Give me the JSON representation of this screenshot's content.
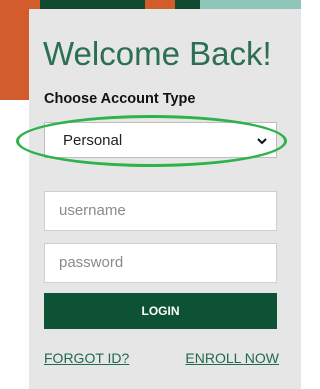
{
  "colors": {
    "brand_green": "#0e5235",
    "title_green": "#2c6f52",
    "accent_orange": "#d25c2c",
    "highlight_green": "#2db34a",
    "panel_bg": "#e6e6e6"
  },
  "login_panel": {
    "title": "Welcome Back!",
    "account_type_label": "Choose Account Type",
    "account_type_select": {
      "value": "Personal",
      "icon": "chevron-down-icon"
    },
    "username_placeholder": "username",
    "password_placeholder": "password",
    "login_label": "LOGIN",
    "forgot_id_label": "FORGOT ID?",
    "enroll_label": "ENROLL NOW"
  }
}
